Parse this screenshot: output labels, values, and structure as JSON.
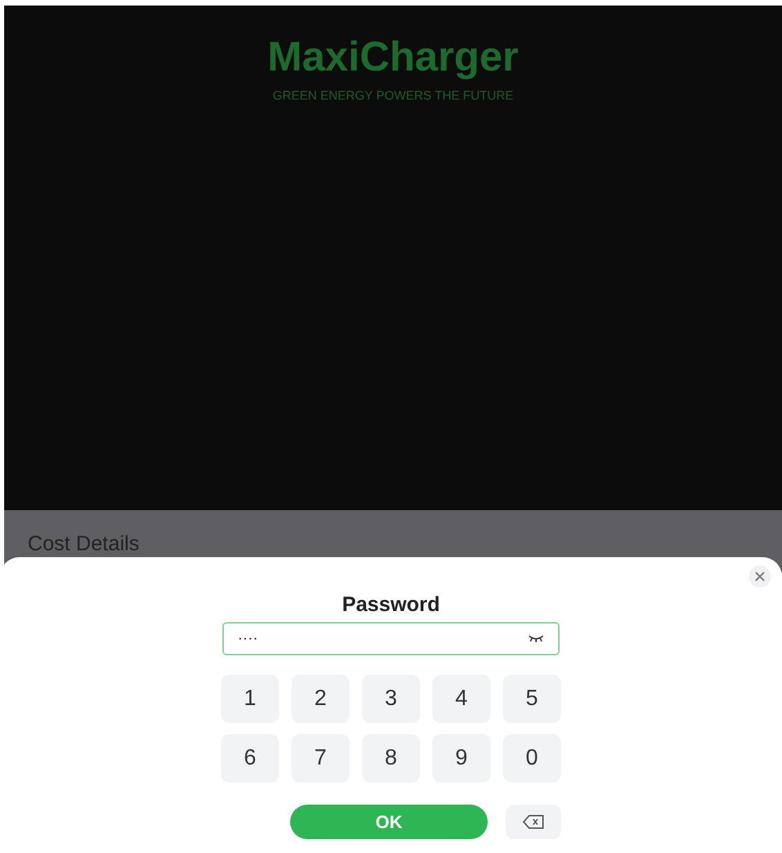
{
  "brand": {
    "name": "MaxiCharger",
    "tagline": "GREEN ENERGY POWERS THE FUTURE"
  },
  "section": {
    "title": "Cost Details"
  },
  "dialog": {
    "title": "Password",
    "field": {
      "value": "····",
      "focused": true
    },
    "keys": [
      "1",
      "2",
      "3",
      "4",
      "5",
      "6",
      "7",
      "8",
      "9",
      "0"
    ],
    "ok": "OK"
  }
}
